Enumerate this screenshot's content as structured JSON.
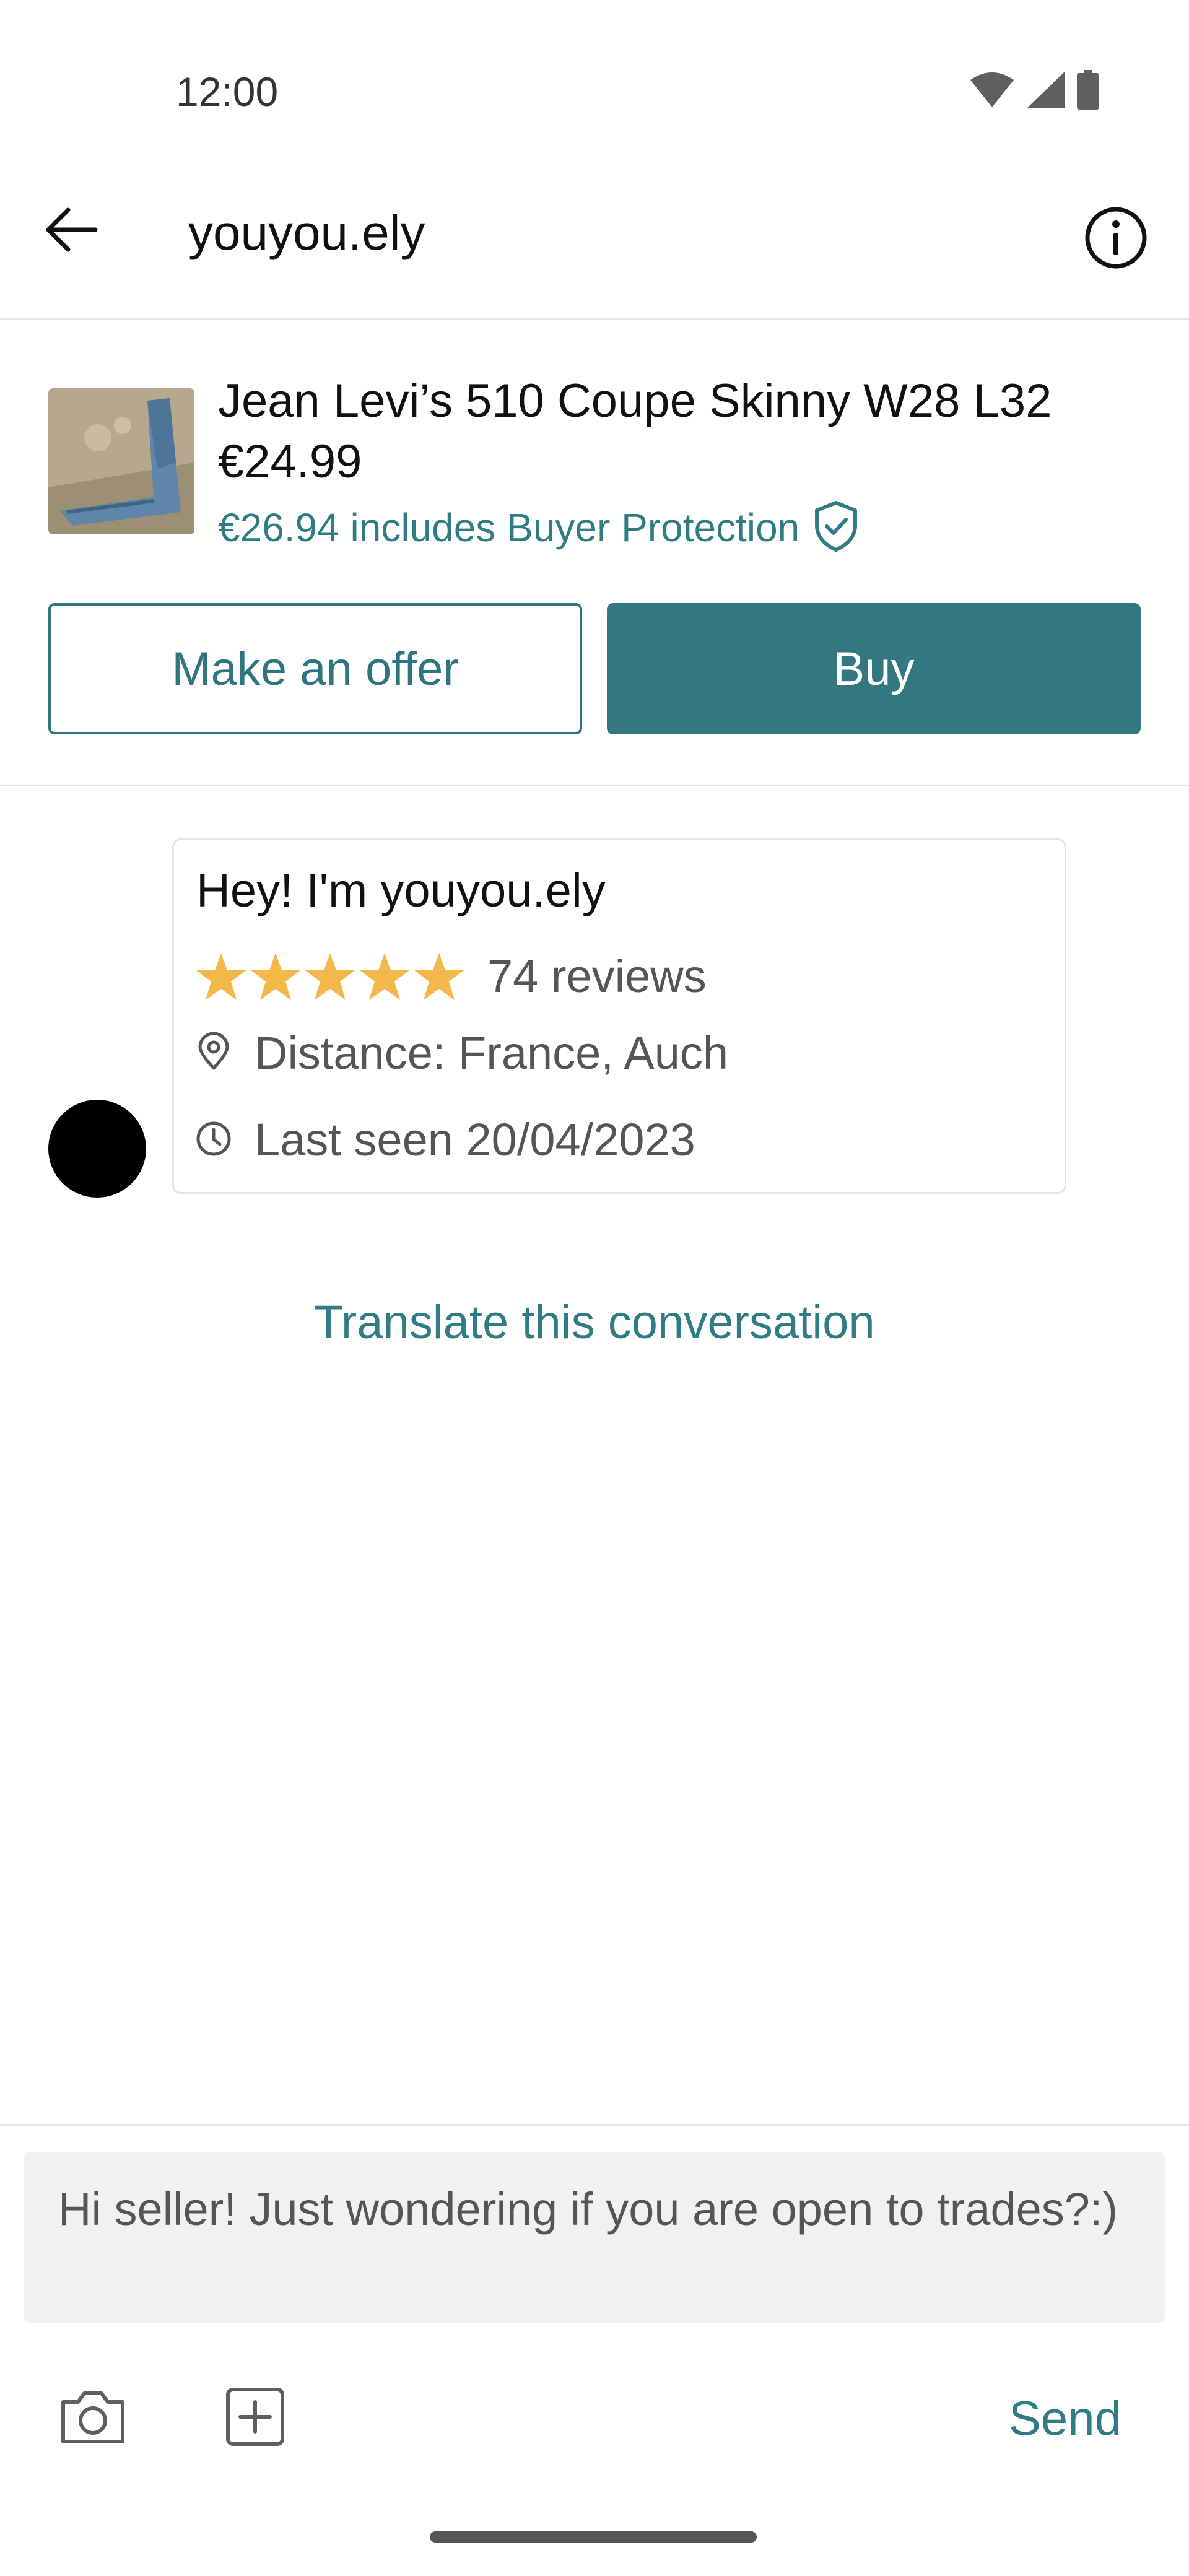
{
  "status_bar": {
    "time": "12:00",
    "icons": [
      "wifi-icon",
      "signal-icon",
      "battery-icon"
    ]
  },
  "app_bar": {
    "title": "youyou.ely",
    "back_icon": "arrow-back-icon",
    "info_icon": "info-icon"
  },
  "item": {
    "title": "Jean Levi’s 510 Coupe Skinny W28 L32",
    "price": "€24.99",
    "protection_text": "€26.94 includes Buyer Protection",
    "protection_icon": "shield-check-icon",
    "offer_label": "Make an offer",
    "buy_label": "Buy"
  },
  "intro": {
    "greeting": "Hey! I'm youyou.ely",
    "rating": 5,
    "rating_max": 5,
    "reviews": "74 reviews",
    "distance": "Distance: France, Auch",
    "last_seen": "Last seen 20/04/2023"
  },
  "translate_label": "Translate this conversation",
  "composer": {
    "message": "Hi seller! Just wondering if you are open to trades?:)",
    "send_label": "Send",
    "camera_icon": "camera-icon",
    "add_icon": "add-box-icon"
  },
  "colors": {
    "accent": "#337781",
    "link": "#2f7c84",
    "star": "#f3b84a",
    "avatar": "#000000"
  }
}
